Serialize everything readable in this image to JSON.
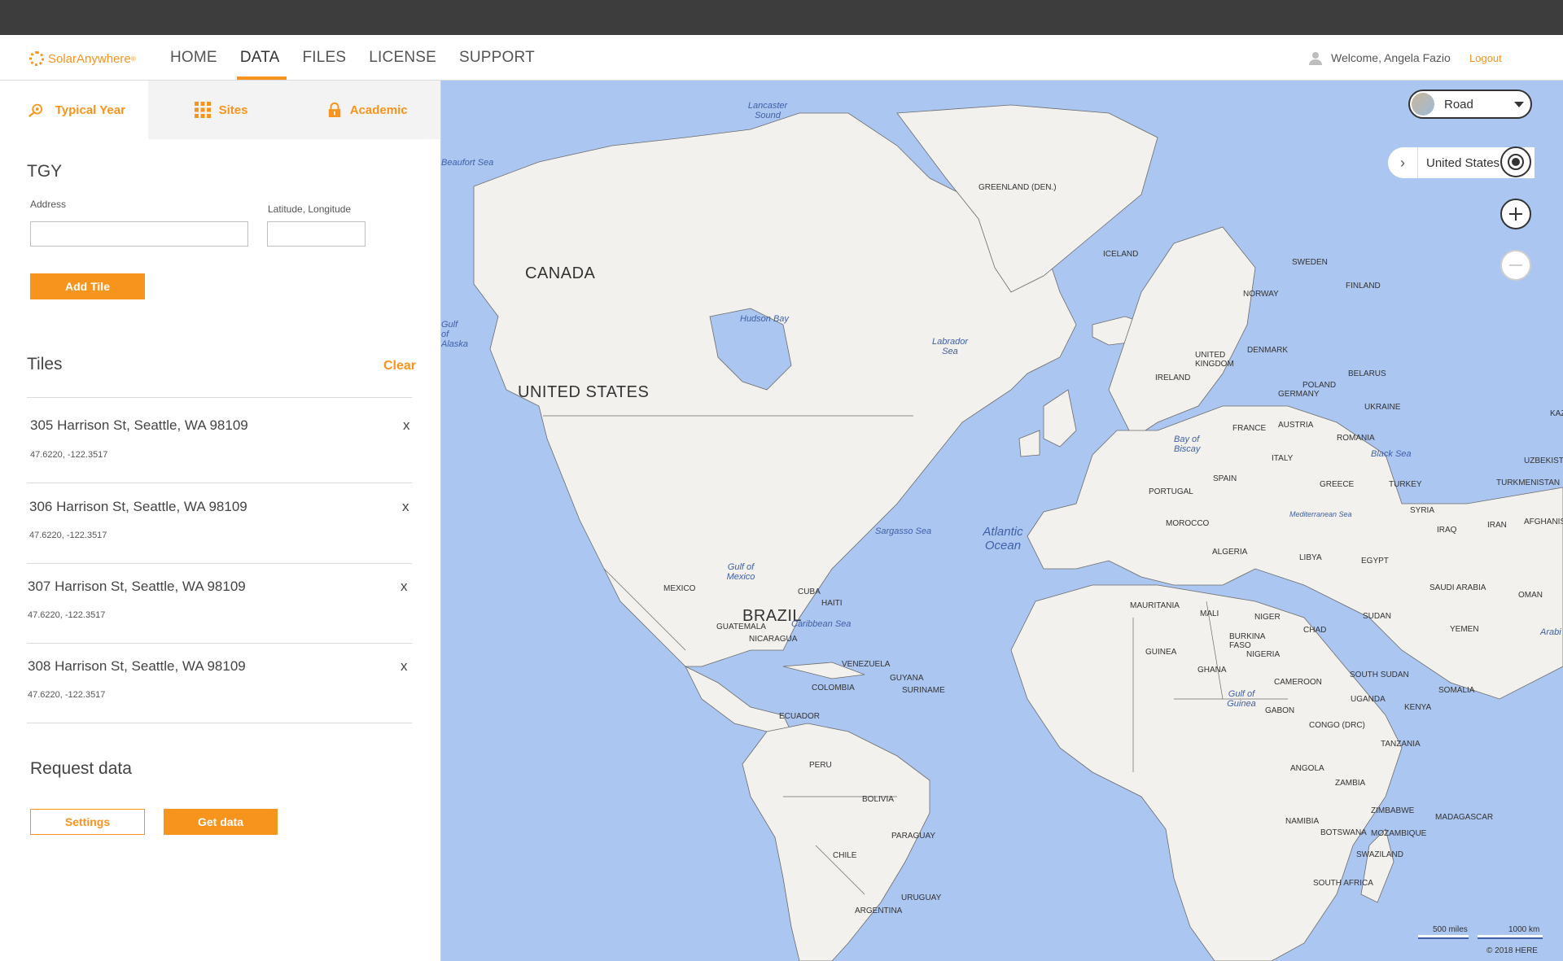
{
  "nav": {
    "logo_text": "SolarAnywhere",
    "logo_mark": "®",
    "menu": [
      {
        "label": "HOME"
      },
      {
        "label": "DATA"
      },
      {
        "label": "FILES"
      },
      {
        "label": "LICENSE"
      },
      {
        "label": "SUPPORT"
      }
    ],
    "welcome": "Welcome, Angela Fazio",
    "logout": "Logout"
  },
  "tabs": [
    {
      "label": "Typical Year",
      "icon": "sun-search-icon",
      "active": true
    },
    {
      "label": "Sites",
      "icon": "grid-icon",
      "active": false
    },
    {
      "label": "Academic",
      "icon": "lock-icon",
      "active": false
    }
  ],
  "tgy": {
    "title": "TGY",
    "address_label": "Address",
    "address_value": "",
    "latlon_label": "Latitude, Longitude",
    "latlon_value": "",
    "add_tile": "Add Tile"
  },
  "tiles": {
    "title": "Tiles",
    "clear": "Clear",
    "items": [
      {
        "address": "305 Harrison St, Seattle, WA 98109",
        "coords": "47.6220,  -122.3517",
        "remove": "x"
      },
      {
        "address": "306 Harrison St, Seattle, WA 98109",
        "coords": "47.6220,  -122.3517",
        "remove": "x"
      },
      {
        "address": "307 Harrison St, Seattle, WA 98109",
        "coords": "47.6220,  -122.3517",
        "remove": "x"
      },
      {
        "address": "308 Harrison St, Seattle, WA 98109",
        "coords": "47.6220,  -122.3517",
        "remove": "x"
      }
    ]
  },
  "request": {
    "title": "Request data",
    "settings": "Settings",
    "get_data": "Get data"
  },
  "map": {
    "style": "Road",
    "location": "United States",
    "scale_miles": "500 miles",
    "scale_km": "1000 km",
    "copyright": "© 2018 HERE",
    "labels_big": [
      "CANADA",
      "UNITED STATES",
      "BRAZIL"
    ],
    "labels_country": [
      "GREENLAND (DEN.)",
      "ICELAND",
      "SWEDEN",
      "FINLAND",
      "NORWAY",
      "UNITED KINGDOM",
      "DENMARK",
      "IRELAND",
      "GERMANY",
      "POLAND",
      "BELARUS",
      "UKRAINE",
      "FRANCE",
      "AUSTRIA",
      "ROMANIA",
      "ITALY",
      "SPAIN",
      "PORTUGAL",
      "GREECE",
      "TURKEY",
      "MOROCCO",
      "ALGERIA",
      "LIBYA",
      "EGYPT",
      "SYRIA",
      "IRAQ",
      "IRAN",
      "SAUDI ARABIA",
      "MAURITANIA",
      "MALI",
      "NIGER",
      "CHAD",
      "SUDAN",
      "NIGERIA",
      "GHANA",
      "CAMEROON",
      "GABON",
      "CONGO (DRC)",
      "KENYA",
      "TANZANIA",
      "ANGOLA",
      "ZAMBIA",
      "ZIMBABWE",
      "NAMIBIA",
      "BOTSWANA",
      "MOZAMBIQUE",
      "MADAGASCAR",
      "SWAZILAND",
      "SOUTH AFRICA",
      "MEXICO",
      "CUBA",
      "HAITI",
      "GUATEMALA",
      "NICARAGUA",
      "VENEZUELA",
      "GUYANA",
      "SURINAME",
      "COLOMBIA",
      "ECUADOR",
      "PERU",
      "BOLIVIA",
      "PARAGUAY",
      "CHILE",
      "URUGUAY",
      "ARGENTINA",
      "UZBEKISTAN",
      "TURKMENISTAN",
      "AFGHANISTAN",
      "KAZ",
      "OMAN",
      "YEMEN",
      "SOMALIA",
      "UGANDA",
      "SOUTH SUDAN",
      "BURKINA FASO",
      "GUINEA"
    ],
    "labels_sea": [
      "Lancaster Sound",
      "Beaufort Sea",
      "Hudson Bay",
      "Labrador Sea",
      "Gulf of Alaska",
      "Bay of Biscay",
      "Black Sea",
      "Mediterranean Sea",
      "Sargasso Sea",
      "Gulf of Mexico",
      "Caribbean Sea",
      "Gulf of Guinea",
      "Arabi"
    ],
    "labels_ocean": [
      "Atlantic Ocean"
    ]
  },
  "colors": {
    "accent": "#f7941d",
    "water": "#abc6f1",
    "land": "#f2f1ee",
    "topbar": "#3d3d3d"
  }
}
